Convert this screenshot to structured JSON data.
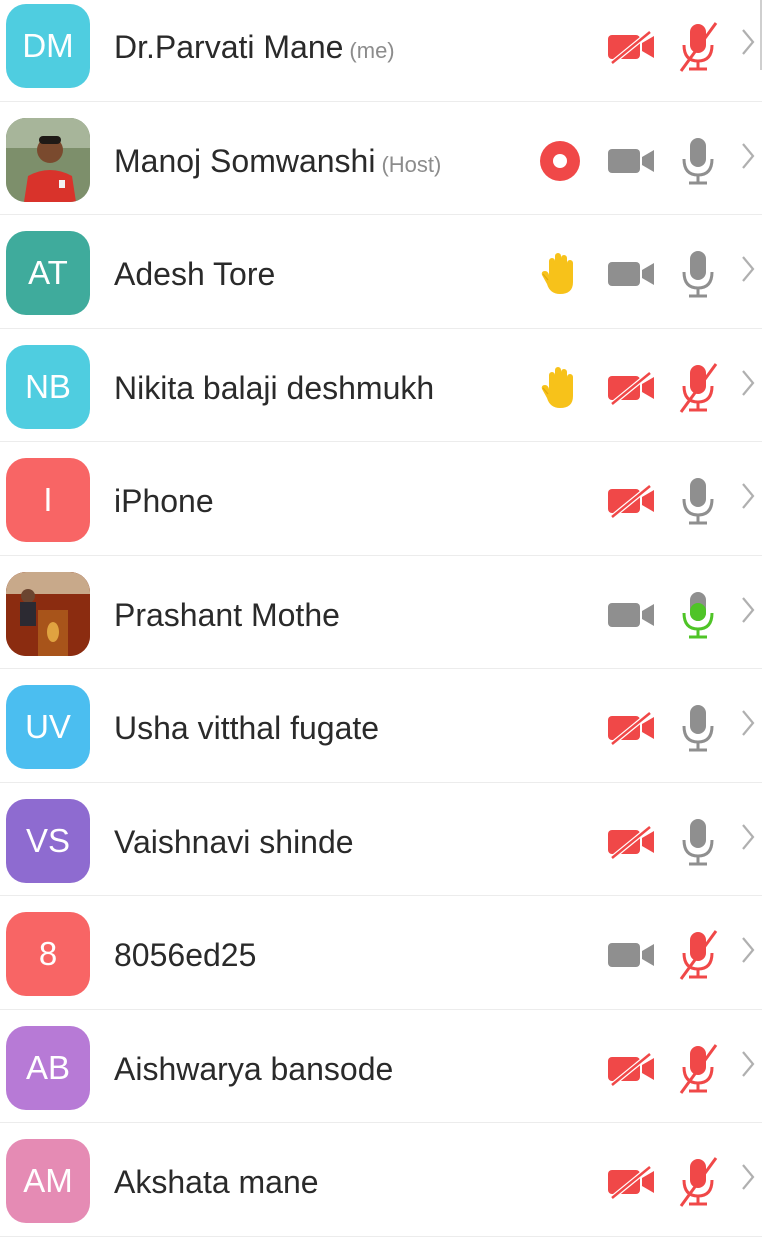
{
  "colors": {
    "muted_red": "#f04848",
    "icon_gray": "#8f8f8f",
    "speaking_green": "#4fc427",
    "hand_yellow": "#f7c21a"
  },
  "participants": [
    {
      "initials": "DM",
      "avatar_color": "#4fcde0",
      "name": "Dr.Parvati Mane",
      "tag": "(me)",
      "record": false,
      "hand": false,
      "video": "off",
      "audio": "muted"
    },
    {
      "initials": "",
      "avatar_color": "#7a8a6a",
      "avatar_photo": true,
      "name": "Manoj Somwanshi",
      "tag": "(Host)",
      "record": true,
      "hand": false,
      "video": "on",
      "audio": "on"
    },
    {
      "initials": "AT",
      "avatar_color": "#3fab9c",
      "name": "Adesh Tore",
      "tag": "",
      "record": false,
      "hand": true,
      "video": "on",
      "audio": "on"
    },
    {
      "initials": "NB",
      "avatar_color": "#4fcde0",
      "name": "Nikita balaji deshmukh",
      "tag": "",
      "record": false,
      "hand": true,
      "video": "off",
      "audio": "muted"
    },
    {
      "initials": "I",
      "avatar_color": "#f86565",
      "name": "iPhone",
      "tag": "",
      "record": false,
      "hand": false,
      "video": "off",
      "audio": "on"
    },
    {
      "initials": "",
      "avatar_color": "#8b2a12",
      "avatar_photo": true,
      "name": "Prashant Mothe",
      "tag": "",
      "record": false,
      "hand": false,
      "video": "on",
      "audio": "speaking"
    },
    {
      "initials": "UV",
      "avatar_color": "#4bbef0",
      "name": "Usha vitthal fugate",
      "tag": "",
      "record": false,
      "hand": false,
      "video": "off",
      "audio": "on"
    },
    {
      "initials": "VS",
      "avatar_color": "#8e6bd0",
      "name": "Vaishnavi shinde",
      "tag": "",
      "record": false,
      "hand": false,
      "video": "off",
      "audio": "on"
    },
    {
      "initials": "8",
      "avatar_color": "#f86565",
      "name": "8056ed25",
      "tag": "",
      "record": false,
      "hand": false,
      "video": "on",
      "audio": "muted"
    },
    {
      "initials": "AB",
      "avatar_color": "#b77ad6",
      "name": "Aishwarya bansode",
      "tag": "",
      "record": false,
      "hand": false,
      "video": "off",
      "audio": "muted"
    },
    {
      "initials": "AM",
      "avatar_color": "#e58bb4",
      "name": "Akshata mane",
      "tag": "",
      "record": false,
      "hand": false,
      "video": "off",
      "audio": "muted"
    }
  ]
}
